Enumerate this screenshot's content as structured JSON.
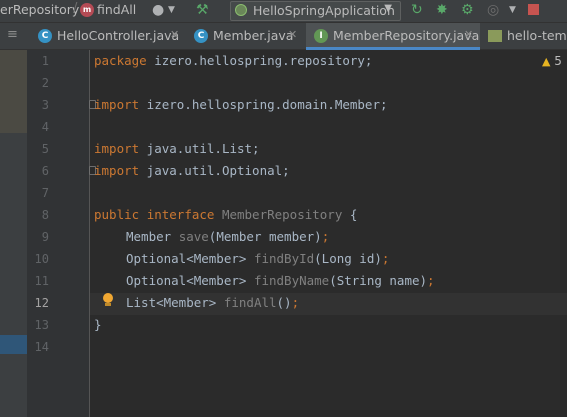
{
  "toolbar": {
    "breadcrumb_file": "erRepository",
    "breadcrumb_sep": "/",
    "breadcrumb_method_icon": "m",
    "breadcrumb_method": "findAll",
    "run_config": "HelloSpringApplication",
    "icons": [
      "user-icon",
      "hammer-icon",
      "rerun-icon",
      "debug-icon",
      "coverage-icon",
      "profile-icon",
      "stop-icon"
    ]
  },
  "tabs": [
    {
      "label": "HelloController.java",
      "icon": "C",
      "icon_color": "#3592c4",
      "active": false
    },
    {
      "label": "Member.java",
      "icon": "C",
      "icon_color": "#3592c4",
      "active": false
    },
    {
      "label": "MemberRepository.java",
      "icon": "I",
      "icon_color": "#629755",
      "active": true
    },
    {
      "label": "hello-temp",
      "icon": "file",
      "active": false
    }
  ],
  "editor": {
    "warning_count": "5",
    "line_numbers": [
      "1",
      "2",
      "3",
      "4",
      "5",
      "6",
      "7",
      "8",
      "9",
      "10",
      "11",
      "12",
      "13",
      "14"
    ],
    "current_line": "12",
    "lines": [
      {
        "kw": "package",
        "rest": " izero.hellospring.repository;"
      },
      {
        "kw": "import",
        "rest": " izero.hellospring.domain.Member;"
      },
      {
        "kw": "import",
        "rest": " java.util.List;"
      },
      {
        "kw": "import",
        "rest": " java.util.Optional;"
      }
    ],
    "interface_decl": {
      "kw1": "public",
      "kw2": "interface",
      "name": "MemberRepository",
      "brace": " {"
    },
    "methods": [
      {
        "ret": "Member ",
        "name": "save",
        "params": "(Member member)"
      },
      {
        "ret": "Optional<Member> ",
        "name": "findById",
        "params": "(Long id)"
      },
      {
        "ret": "Optional<Member> ",
        "name": "findByName",
        "params": "(String name)"
      },
      {
        "ret": "List<Member> ",
        "name": "findAll",
        "params": "()"
      }
    ],
    "closing": "}"
  },
  "colors": {
    "keyword": "#cc7832",
    "text": "#a9b7c6",
    "unused": "#808080",
    "background": "#2b2b2b"
  }
}
